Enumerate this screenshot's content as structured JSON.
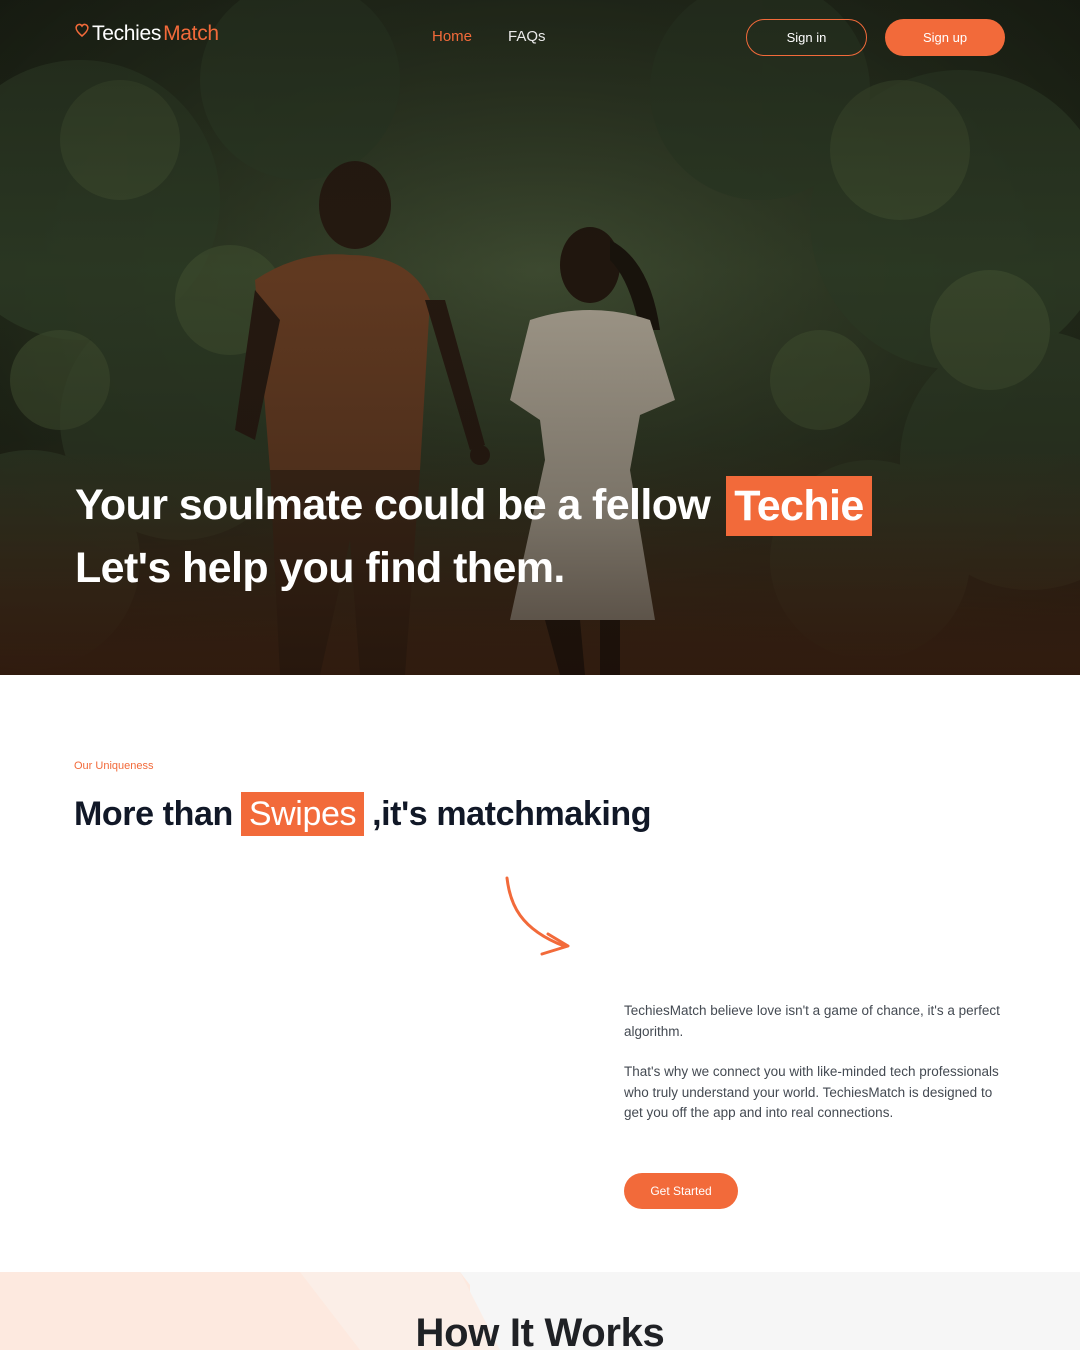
{
  "brand": {
    "name_part1": "Techies",
    "name_part2": "Match",
    "accent_color": "#f26a3a"
  },
  "nav": {
    "links": [
      {
        "label": "Home",
        "active": true
      },
      {
        "label": "FAQs",
        "active": false
      }
    ],
    "signin_label": "Sign in",
    "signup_label": "Sign up"
  },
  "hero": {
    "line1": "Your soulmate could be a fellow",
    "line1_highlight": "Techie",
    "line2": "Let's help you find them."
  },
  "uniqueness": {
    "eyebrow": "Our Uniqueness",
    "title_before": "More than",
    "title_highlight": "Swipes",
    "title_after": ",it's matchmaking",
    "paragraph1": "TechiesMatch believe love isn't a game of chance, it's a perfect algorithm.",
    "paragraph2": "That's why we connect you with like-minded tech professionals who truly understand your world. TechiesMatch is designed to get you off the app and into real connections.",
    "cta_label": "Get Started"
  },
  "how_it_works": {
    "title": "How It Works"
  }
}
